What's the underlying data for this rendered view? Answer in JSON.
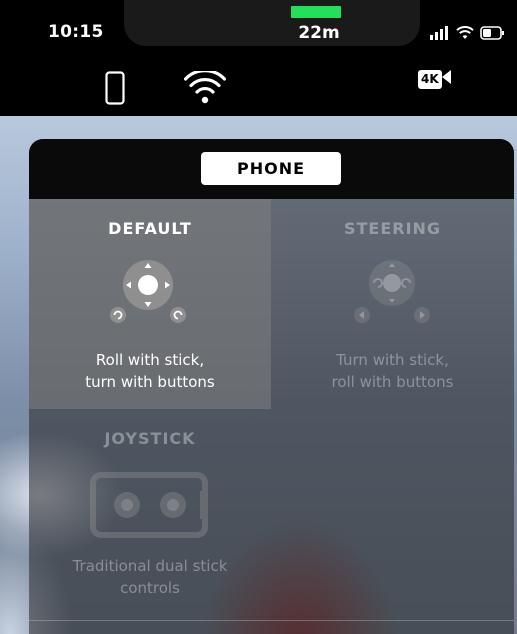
{
  "status_bar": {
    "time": "10:15",
    "icons": [
      "signal-icon",
      "wifi-icon",
      "battery-icon"
    ]
  },
  "toolbar": {
    "phone_icon": "phone-icon",
    "wifi_icon": "wifi-icon",
    "battery_level": 1.0,
    "battery_color": "#22e05a",
    "distance": "22m",
    "camera_badge": "4K"
  },
  "panel": {
    "tab_label": "PHONE",
    "modes": [
      {
        "title": "DEFAULT",
        "description_line1": "Roll with stick,",
        "description_line2": "turn with buttons",
        "selected": true
      },
      {
        "title": "STEERING",
        "description_line1": "Turn with stick,",
        "description_line2": "roll with buttons",
        "selected": false
      },
      {
        "title": "JOYSTICK",
        "description_line1": "Traditional dual stick",
        "description_line2": "controls",
        "selected": false
      }
    ]
  }
}
